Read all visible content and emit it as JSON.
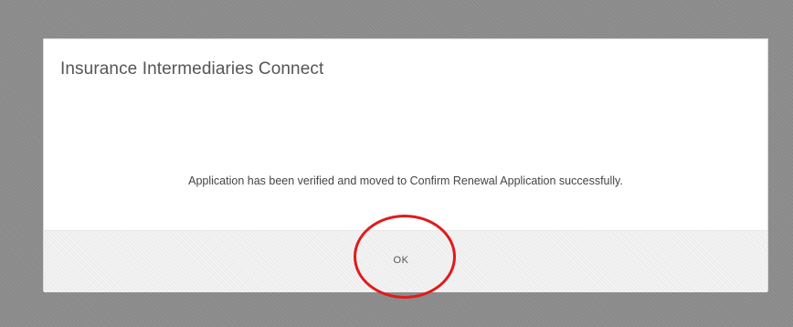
{
  "dialog": {
    "title": "Insurance Intermediaries Connect",
    "message": "Application has been verified and moved to Confirm Renewal Application successfully.",
    "ok_label": "OK"
  },
  "annotation": {
    "highlight_color": "#e01b1b"
  }
}
